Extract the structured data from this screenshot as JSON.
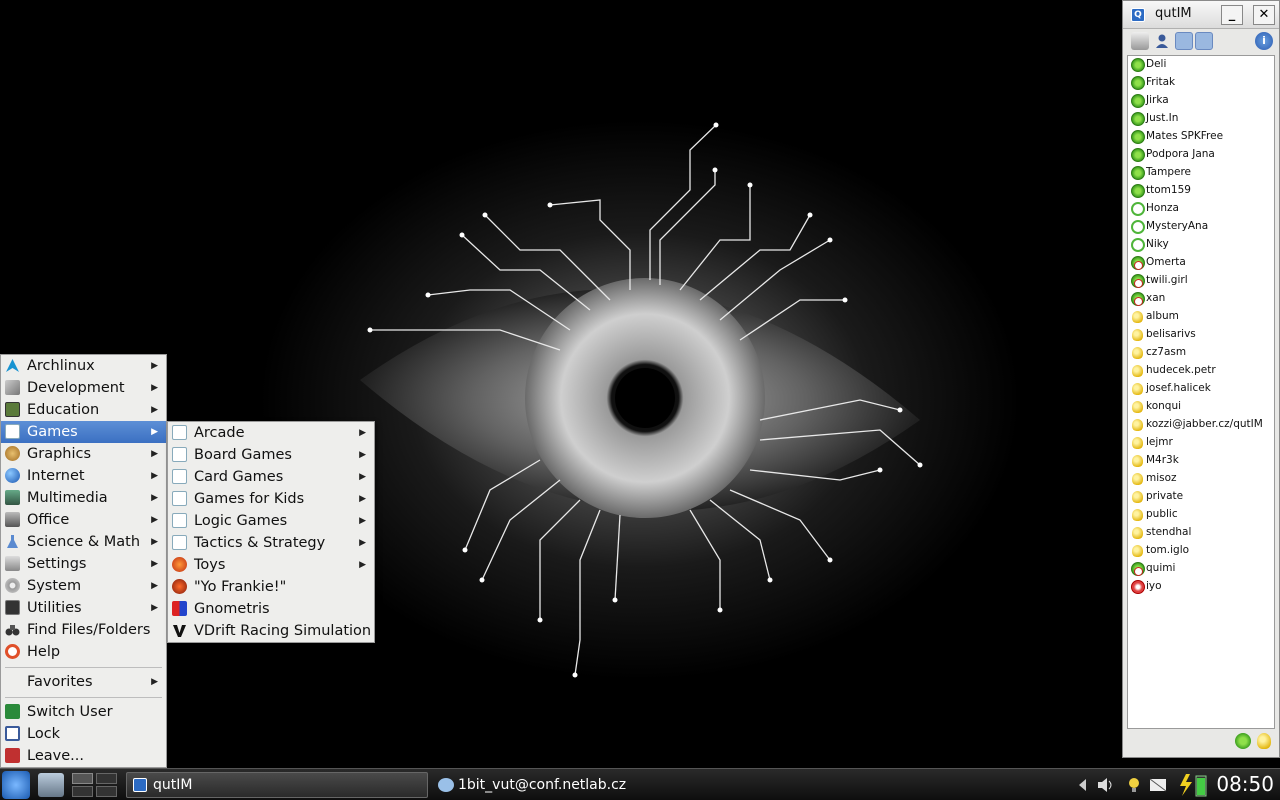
{
  "main_menu": {
    "items": [
      {
        "label": "Archlinux",
        "icon": "archlinux-icon",
        "submenu": true
      },
      {
        "label": "Development",
        "icon": "development-icon",
        "submenu": true
      },
      {
        "label": "Education",
        "icon": "education-icon",
        "submenu": true
      },
      {
        "label": "Games",
        "icon": "games-icon",
        "submenu": true,
        "selected": true
      },
      {
        "label": "Graphics",
        "icon": "graphics-icon",
        "submenu": true
      },
      {
        "label": "Internet",
        "icon": "internet-globe-icon",
        "submenu": true
      },
      {
        "label": "Multimedia",
        "icon": "multimedia-icon",
        "submenu": true
      },
      {
        "label": "Office",
        "icon": "office-icon",
        "submenu": true
      },
      {
        "label": "Science & Math",
        "icon": "science-flask-icon",
        "submenu": true
      },
      {
        "label": "Settings",
        "icon": "settings-icon",
        "submenu": true
      },
      {
        "label": "System",
        "icon": "system-gear-icon",
        "submenu": true
      },
      {
        "label": "Utilities",
        "icon": "utilities-icon",
        "submenu": true
      },
      {
        "label": "Find Files/Folders",
        "icon": "binoculars-icon",
        "submenu": false
      },
      {
        "label": "Help",
        "icon": "help-lifebuoy-icon",
        "submenu": false
      }
    ],
    "favorites": "Favorites",
    "session": [
      {
        "label": "Switch User",
        "icon": "switch-user-icon"
      },
      {
        "label": "Lock",
        "icon": "lock-icon"
      },
      {
        "label": "Leave...",
        "icon": "leave-power-icon"
      }
    ]
  },
  "games_menu": {
    "items": [
      {
        "label": "Arcade",
        "icon": "folder-doc-icon",
        "submenu": true
      },
      {
        "label": "Board Games",
        "icon": "folder-doc-icon",
        "submenu": true
      },
      {
        "label": "Card Games",
        "icon": "folder-doc-icon",
        "submenu": true
      },
      {
        "label": "Games for Kids",
        "icon": "folder-doc-icon",
        "submenu": true
      },
      {
        "label": "Logic Games",
        "icon": "folder-doc-icon",
        "submenu": true
      },
      {
        "label": "Tactics & Strategy",
        "icon": "folder-doc-icon",
        "submenu": true
      },
      {
        "label": "Toys",
        "icon": "toys-icon",
        "submenu": true
      },
      {
        "label": "\"Yo Frankie!\"",
        "icon": "yo-frankie-icon",
        "submenu": false
      },
      {
        "label": "Gnometris",
        "icon": "gnometris-icon",
        "submenu": false
      },
      {
        "label": "VDrift Racing Simulation",
        "icon": "vdrift-icon",
        "submenu": false
      }
    ]
  },
  "qutim": {
    "title": "qutIM",
    "minimize": "_",
    "close": "✕",
    "contacts": [
      {
        "name": "Deli",
        "status": "online"
      },
      {
        "name": "Fritak",
        "status": "online"
      },
      {
        "name": "Jirka",
        "status": "online"
      },
      {
        "name": "Just.In",
        "status": "online"
      },
      {
        "name": "Mates SPKFree",
        "status": "online"
      },
      {
        "name": "Podpora Jana",
        "status": "online"
      },
      {
        "name": "Tampere",
        "status": "online"
      },
      {
        "name": "ttom159",
        "status": "online"
      },
      {
        "name": "Honza",
        "status": "offline"
      },
      {
        "name": "MysteryAna",
        "status": "offline"
      },
      {
        "name": "Niky",
        "status": "offline"
      },
      {
        "name": "Omerta",
        "status": "away"
      },
      {
        "name": "twili.girl",
        "status": "away"
      },
      {
        "name": "xan",
        "status": "away"
      },
      {
        "name": "album",
        "status": "bulb"
      },
      {
        "name": "belisarivs",
        "status": "bulb"
      },
      {
        "name": "cz7asm",
        "status": "bulb"
      },
      {
        "name": "hudecek.petr",
        "status": "bulb"
      },
      {
        "name": "josef.halicek",
        "status": "bulb"
      },
      {
        "name": "konqui",
        "status": "bulb"
      },
      {
        "name": "kozzi@jabber.cz/qutIM",
        "status": "bulb"
      },
      {
        "name": "lejmr",
        "status": "bulb"
      },
      {
        "name": "M4r3k",
        "status": "bulb"
      },
      {
        "name": "misoz",
        "status": "bulb"
      },
      {
        "name": "private",
        "status": "bulb"
      },
      {
        "name": "public",
        "status": "bulb"
      },
      {
        "name": "stendhal",
        "status": "bulb"
      },
      {
        "name": "tom.iglo",
        "status": "bulb"
      },
      {
        "name": "quimi",
        "status": "away"
      },
      {
        "name": "iyo",
        "status": "error"
      }
    ]
  },
  "taskbar": {
    "task_qutim": "qutIM",
    "task_conf": "1bit_vut@conf.netlab.cz",
    "clock": "08:50"
  }
}
